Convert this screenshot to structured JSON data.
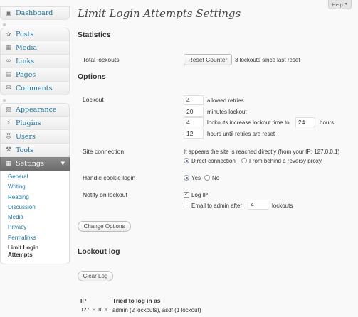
{
  "help_label": "Help",
  "sidebar": {
    "group1": [
      {
        "label": "Dashboard",
        "icon": "dashboard-icon"
      }
    ],
    "group2": [
      {
        "label": "Posts",
        "icon": "pushpin-icon"
      },
      {
        "label": "Media",
        "icon": "media-icon"
      },
      {
        "label": "Links",
        "icon": "link-icon"
      },
      {
        "label": "Pages",
        "icon": "pages-icon"
      },
      {
        "label": "Comments",
        "icon": "comment-icon"
      }
    ],
    "group3": [
      {
        "label": "Appearance",
        "icon": "appearance-icon"
      },
      {
        "label": "Plugins",
        "icon": "plugin-icon"
      },
      {
        "label": "Users",
        "icon": "users-icon"
      },
      {
        "label": "Tools",
        "icon": "tools-icon"
      },
      {
        "label": "Settings",
        "icon": "settings-icon"
      }
    ],
    "submenu": [
      {
        "label": "General"
      },
      {
        "label": "Writing"
      },
      {
        "label": "Reading"
      },
      {
        "label": "Discussion"
      },
      {
        "label": "Media"
      },
      {
        "label": "Privacy"
      },
      {
        "label": "Permalinks"
      },
      {
        "label": "Limit Login Attempts"
      }
    ]
  },
  "page": {
    "title": "Limit Login Attempts Settings",
    "statistics_heading": "Statistics",
    "total_lockouts_label": "Total lockouts",
    "reset_counter_label": "Reset Counter",
    "lockouts_since_reset": "3 lockouts since last reset",
    "options_heading": "Options",
    "lockout_label": "Lockout",
    "allowed_retries_value": "4",
    "allowed_retries_text": "allowed retries",
    "minutes_lockout_value": "20",
    "minutes_lockout_text": "minutes lockout",
    "lockouts_increase_value": "4",
    "lockouts_increase_text": "lockouts increase lockout time to",
    "increase_hours_value": "24",
    "hours_text": "hours",
    "hours_until_reset_value": "12",
    "hours_until_reset_text": "hours until retries are reset",
    "site_connection_label": "Site connection",
    "site_connection_info": "It appears the site is reached directly (from your IP: 127.0.0.1)",
    "direct_connection_label": "Direct connection",
    "behind_proxy_label": "From behind a reversy proxy",
    "handle_cookie_label": "Handle cookie login",
    "yes_label": "Yes",
    "no_label": "No",
    "notify_label": "Notify on lockout",
    "log_ip_label": "Log IP",
    "email_admin_label": "Email to admin after",
    "email_after_value": "4",
    "lockouts_text": "lockouts",
    "change_options_label": "Change Options",
    "lockout_log_heading": "Lockout log",
    "clear_log_label": "Clear Log",
    "log_table": {
      "headers": [
        "IP",
        "Tried to log in as"
      ],
      "rows": [
        [
          "127.0.0.1",
          "admin (2 lockouts), asdf (1 lockout)"
        ]
      ]
    }
  }
}
